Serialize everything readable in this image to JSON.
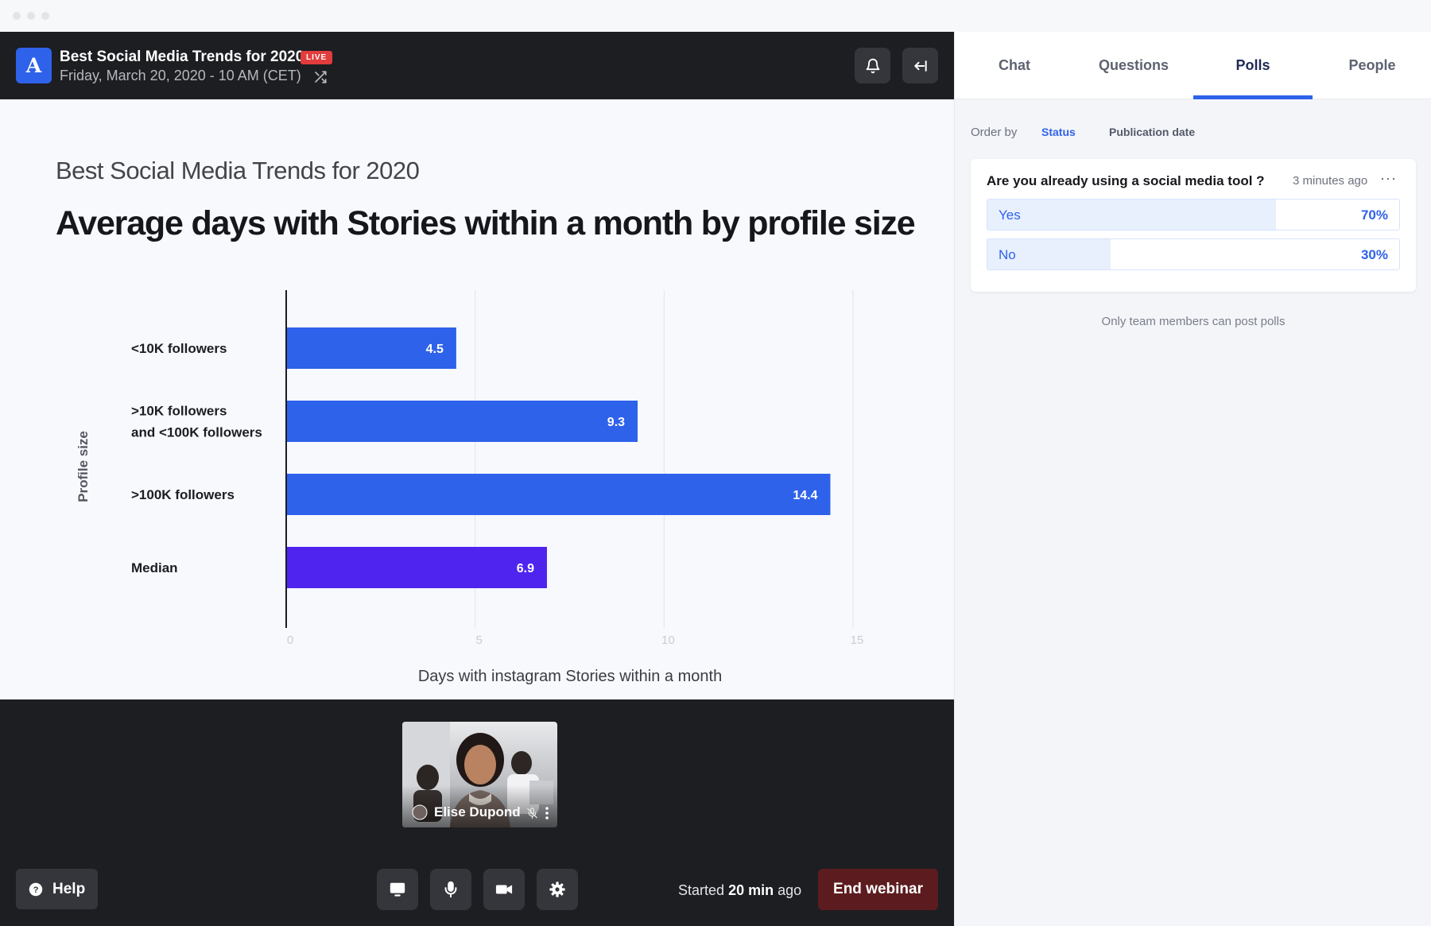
{
  "event": {
    "logo_letter": "A",
    "title": "Best Social Media Trends for 2020",
    "live_label": "LIVE",
    "date": "Friday, March 20, 2020 - 10 AM (CET)"
  },
  "slide": {
    "subtitle": "Best Social Media Trends for 2020",
    "title": "Average days with Stories within a month by profile size"
  },
  "chart_data": {
    "type": "bar",
    "orientation": "horizontal",
    "categories": [
      [
        "<10K followers"
      ],
      [
        ">10K followers",
        "and <100K followers"
      ],
      [
        ">100K followers"
      ],
      [
        "Median"
      ]
    ],
    "values": [
      4.5,
      9.3,
      14.4,
      6.9
    ],
    "data_labels": [
      "4.5",
      "9.3",
      "14.4",
      "6.9"
    ],
    "xlabel": "Days with instagram Stories within a month",
    "ylabel": "Profile size",
    "xticks": [
      "0",
      "5",
      "10",
      "15"
    ],
    "xlim": [
      0,
      15
    ],
    "grid": true,
    "colors": [
      "#2f62ea",
      "#2f62ea",
      "#2f62ea",
      "#4f24ee"
    ]
  },
  "video": {
    "participant_name": "Elise Dupond"
  },
  "controls": {
    "help_label": "Help",
    "started_prefix": "Started",
    "started_value": "20 min",
    "started_suffix": "ago",
    "end_label": "End webinar"
  },
  "panel": {
    "tabs": [
      {
        "label": "Chat",
        "active": false
      },
      {
        "label": "Questions",
        "active": false
      },
      {
        "label": "Polls",
        "active": true
      },
      {
        "label": "People",
        "active": false
      }
    ],
    "order_by_label": "Order by",
    "order_options": [
      {
        "label": "Status",
        "active": true
      },
      {
        "label": "Publication date",
        "active": false
      }
    ],
    "poll": {
      "question": "Are you already using a social media tool ?",
      "time": "3 minutes ago",
      "more": "···",
      "options": [
        {
          "label": "Yes",
          "percent_label": "70%",
          "fraction": 0.7
        },
        {
          "label": "No",
          "percent_label": "30%",
          "fraction": 0.3
        }
      ]
    },
    "note": "Only team members can post polls"
  },
  "colors": {
    "accent": "#2f62ea",
    "median_bar": "#4f24ee",
    "live_badge": "#e23c3c",
    "end_button": "#5c1c1f",
    "dark_bg": "#1d1e22"
  }
}
